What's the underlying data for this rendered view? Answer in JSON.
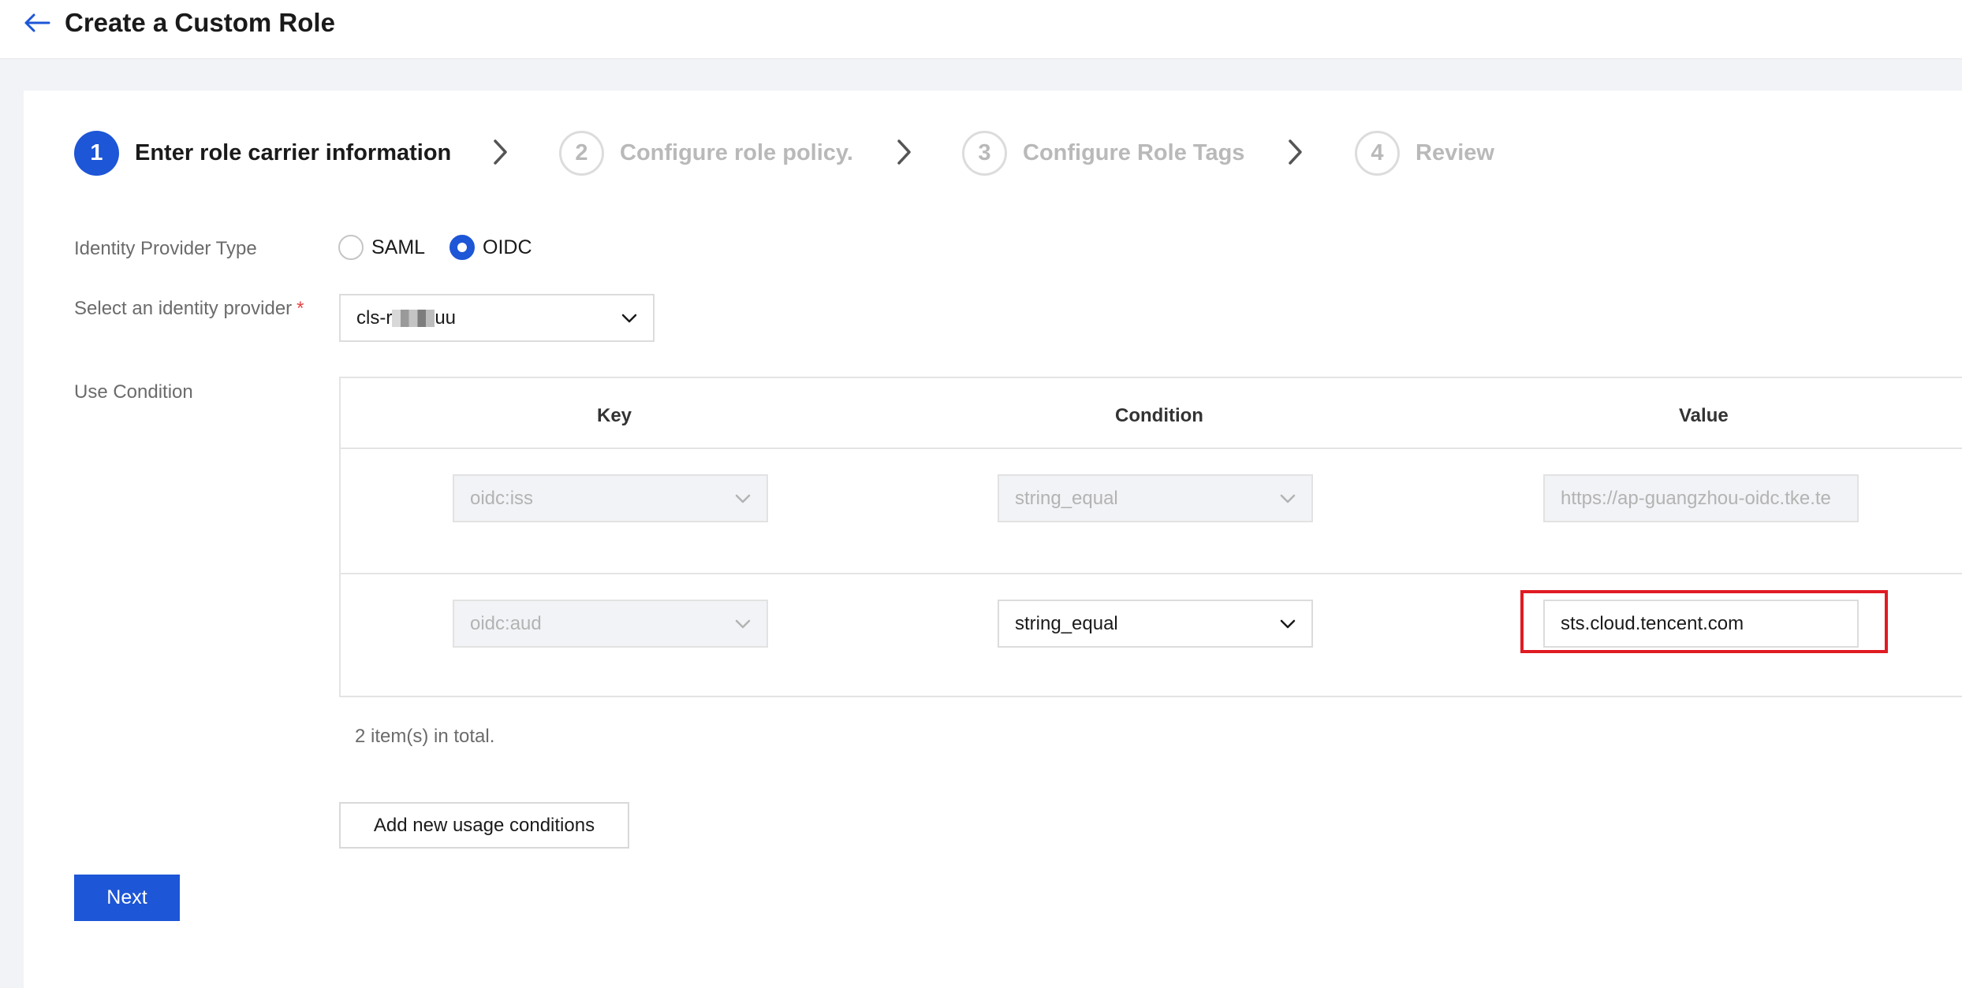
{
  "header": {
    "title": "Create a Custom Role"
  },
  "steps": [
    {
      "number": "1",
      "label": "Enter role carrier information",
      "state": "active"
    },
    {
      "number": "2",
      "label": "Configure role policy.",
      "state": "inactive"
    },
    {
      "number": "3",
      "label": "Configure Role Tags",
      "state": "inactive"
    },
    {
      "number": "4",
      "label": "Review",
      "state": "inactive"
    }
  ],
  "form": {
    "idp_type_label": "Identity Provider Type",
    "idp_type_options": [
      {
        "label": "SAML",
        "checked": false
      },
      {
        "label": "OIDC",
        "checked": true
      }
    ],
    "idp_select_label": "Select an identity provider",
    "required_mark": "*",
    "idp_select_value_prefix": "cls-r",
    "idp_select_value_suffix": "uu",
    "use_condition_label": "Use Condition"
  },
  "table": {
    "headers": {
      "key": "Key",
      "condition": "Condition",
      "value": "Value"
    },
    "rows": [
      {
        "key": "oidc:iss",
        "condition": "string_equal",
        "value": "https://ap-guangzhou-oidc.tke.te",
        "editable": false
      },
      {
        "key": "oidc:aud",
        "condition": "string_equal",
        "value": "sts.cloud.tencent.com",
        "editable": true
      }
    ],
    "total_text": "2 item(s) in total."
  },
  "buttons": {
    "add_condition": "Add new usage conditions",
    "next": "Next"
  },
  "colors": {
    "primary": "#1d56d6",
    "highlight": "#e01b22",
    "required": "#e54545"
  }
}
